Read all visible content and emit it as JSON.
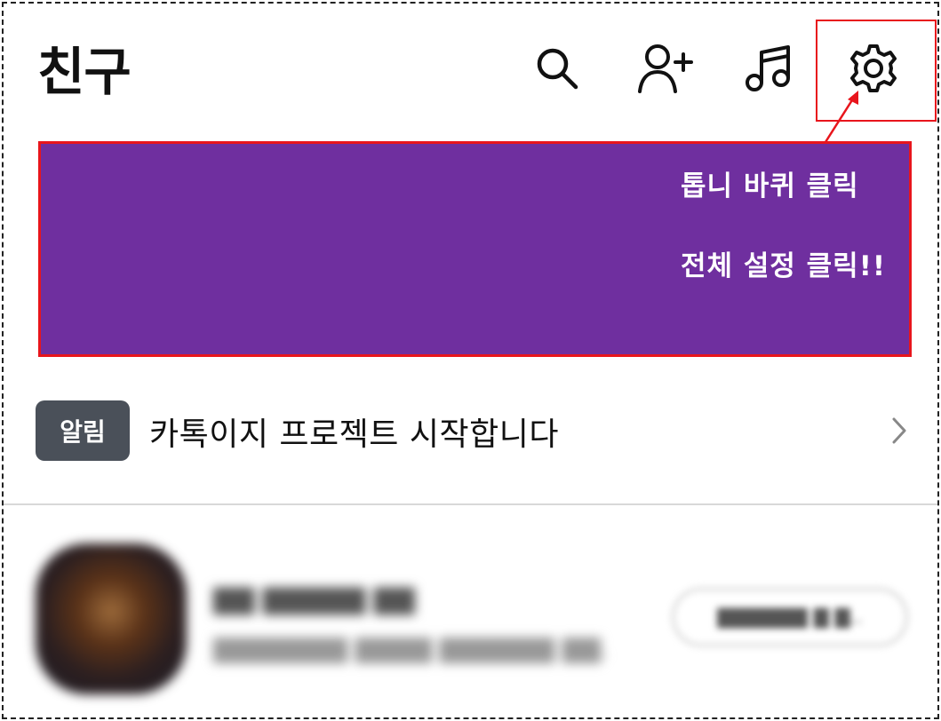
{
  "header": {
    "title": "친구",
    "icons": [
      "search-icon",
      "add-friend-icon",
      "music-icon",
      "settings-icon"
    ]
  },
  "annotation": {
    "line1": "톱니 바퀴 클릭",
    "line2": "전체 설정 클릭!!",
    "banner_color": "#6f2f9f",
    "highlight_color": "#e8151c"
  },
  "notice": {
    "badge": "알림",
    "text": "카톡이지 프로젝트 시작합니다"
  }
}
